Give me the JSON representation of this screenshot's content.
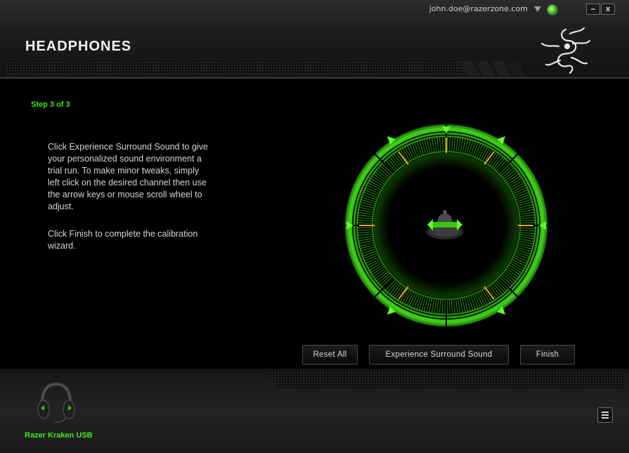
{
  "header": {
    "account_email": "john.doe@razerzone.com",
    "minimize_label": "–",
    "close_label": "x",
    "title": "HEADPHONES"
  },
  "main": {
    "step": "Step 3 of 3",
    "instruction_1": "Click Experience Surround Sound to give your personalized sound environment a trial run. To make minor tweaks, simply left click on the desired channel then use the arrow keys or mouse scroll wheel to adjust.",
    "instruction_2": "Click Finish to complete the calibration wizard."
  },
  "buttons": {
    "reset": "Reset All",
    "experience": "Experience Surround Sound",
    "finish": "Finish"
  },
  "footer": {
    "device_name": "Razer Kraken USB"
  },
  "colors": {
    "accent_green": "#46e61b",
    "channel_marker": "#f0a020"
  },
  "icons": [
    "chevron-down-icon",
    "status-orb-icon",
    "razer-logo-icon",
    "listener-icon",
    "headset-icon",
    "menu-icon"
  ]
}
